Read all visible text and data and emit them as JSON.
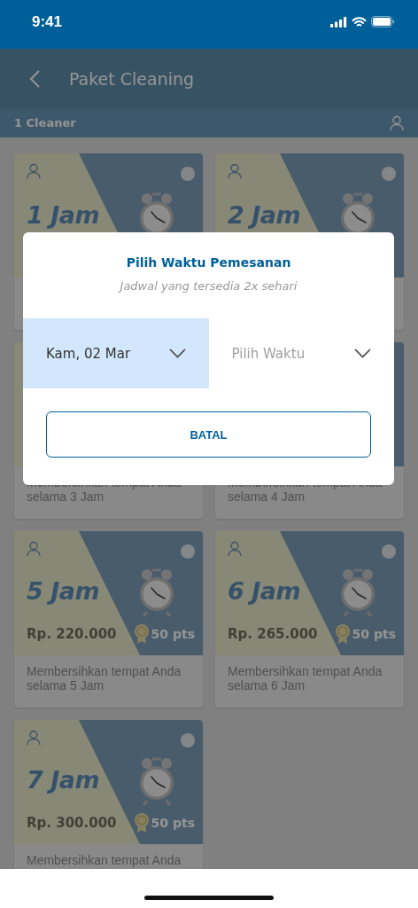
{
  "status_bar": {
    "time": "9:41"
  },
  "header": {
    "title": "Paket Cleaning"
  },
  "cleaner_bar": {
    "label": "1 Cleaner"
  },
  "packages": [
    {
      "title": "1 Jam",
      "selected": false
    },
    {
      "title": "2 Jam",
      "selected": false
    },
    {
      "description": "Membersihkan tempat Anda selama 3 Jam"
    },
    {
      "description": "Membersihkan tempat Anda selama 4 Jam"
    },
    {
      "title": "5 Jam",
      "price": "Rp. 220.000",
      "points": "50 pts",
      "description": "Membersihkan tempat Anda selama 5 Jam",
      "selected": false
    },
    {
      "title": "6 Jam",
      "price": "Rp. 265.000",
      "points": "50 pts",
      "description": "Membersihkan tempat Anda selama 6 Jam",
      "selected": false
    },
    {
      "title": "7 Jam",
      "price": "Rp. 300.000",
      "points": "50 pts",
      "description": "Membersihkan tempat Anda",
      "selected": false
    }
  ],
  "dialog": {
    "title": "Pilih Waktu Pemesanan",
    "subtitle": "Jadwal yang tersedia 2x sehari",
    "pickers": [
      {
        "value": "Kam, 02 Mar",
        "active": true
      },
      {
        "placeholder": "Pilih Waktu",
        "active": false
      }
    ],
    "cancel_button": "BATAL"
  }
}
